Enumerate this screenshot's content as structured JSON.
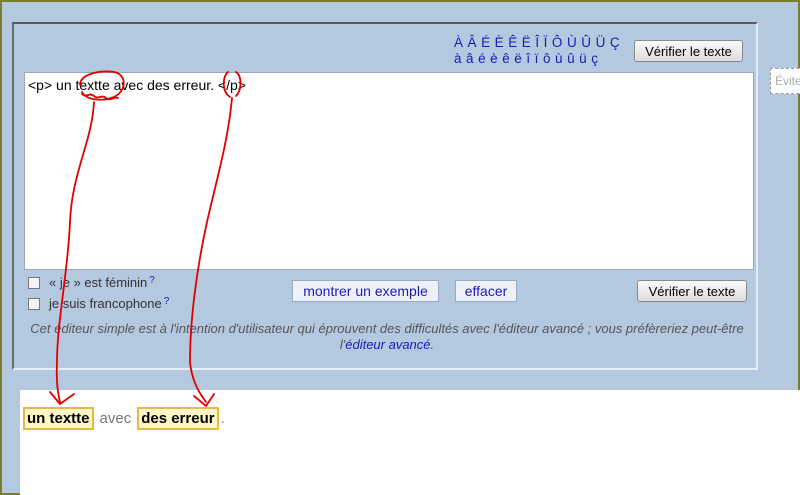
{
  "accents": {
    "upper": "À Â É È Ê Ë Î Ï Ô Ù Û Ü Ç",
    "lower": "à â é è ê ë î ï ô ù û ü ç"
  },
  "editor": {
    "verify_top_label": "Vérifier le texte",
    "text": "<p>  un textte avec des erreur. </p>",
    "side_placeholder": "Évite"
  },
  "options": {
    "feminine_label": "« je » est féminin",
    "francophone_label": "je suis francophone",
    "help_mark": "?"
  },
  "actions": {
    "example_label": "montrer un exemple",
    "clear_label": "effacer",
    "verify_bottom_label": "Vérifier le texte"
  },
  "note": {
    "text": "Cet éditeur simple est à l'intention d'utilisateur qui éprouvent des difficultés avec l'éditeur avancé ; vous préfèreriez peut-être l'",
    "link": "éditeur avancé",
    "end": "."
  },
  "results": {
    "error1": "un textte",
    "plain": "avec",
    "error2": "des erreur",
    "end": ".",
    "error_border_color": "#e8b840"
  },
  "annotation_color": "#e00000"
}
